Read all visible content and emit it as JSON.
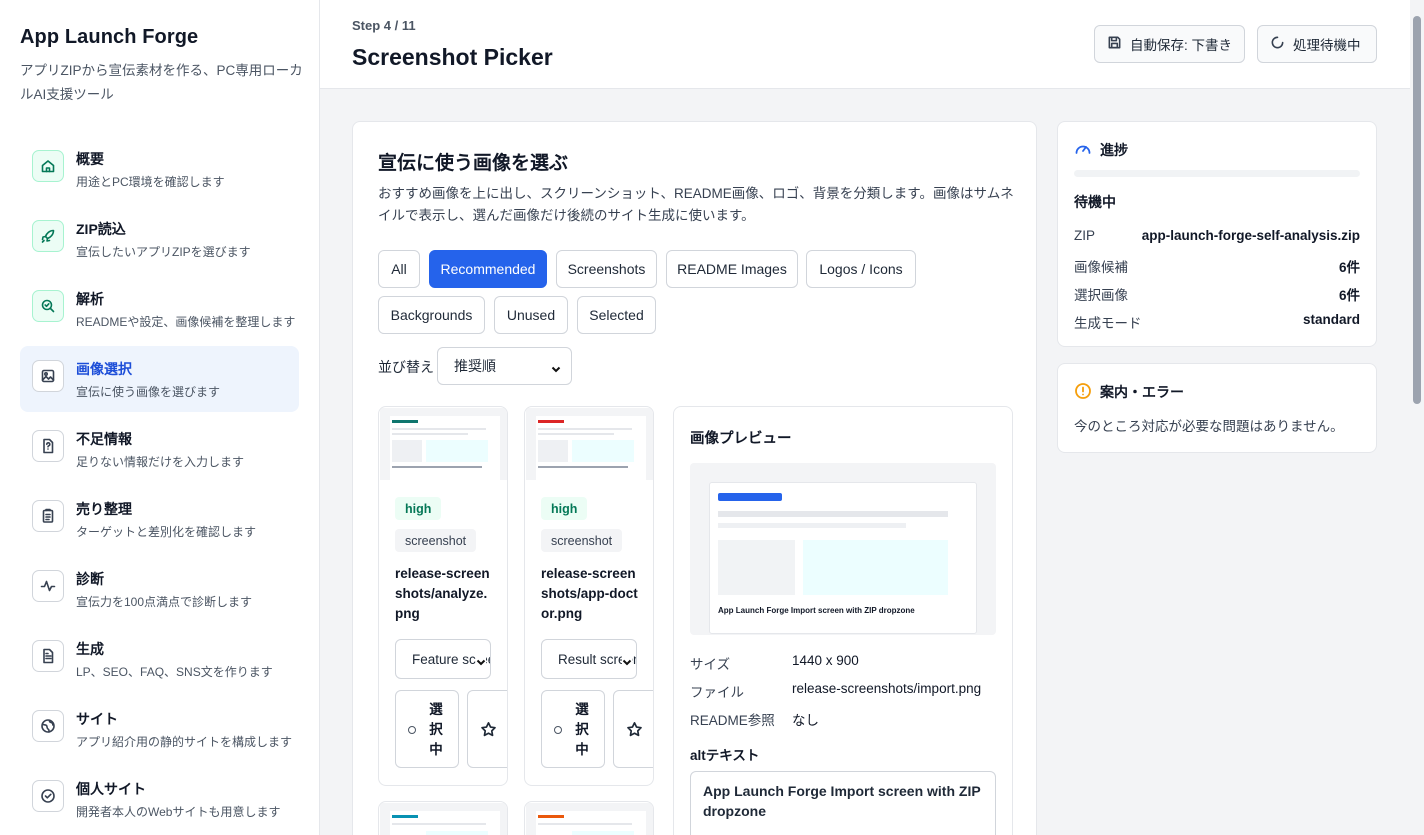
{
  "brand": {
    "title": "App Launch Forge",
    "subtitle": "アプリZIPから宣伝素材を作る、PC専用ローカルAI支援ツール"
  },
  "nav": [
    {
      "label": "概要",
      "desc": "用途とPC環境を確認します",
      "icon": "home-icon"
    },
    {
      "label": "ZIP読込",
      "desc": "宣伝したいアプリZIPを選びます",
      "icon": "rocket-icon"
    },
    {
      "label": "解析",
      "desc": "READMEや設定、画像候補を整理します",
      "icon": "search-check-icon"
    },
    {
      "label": "画像選択",
      "desc": "宣伝に使う画像を選びます",
      "icon": "image-icon",
      "active": true
    },
    {
      "label": "不足情報",
      "desc": "足りない情報だけを入力します",
      "icon": "question-icon"
    },
    {
      "label": "売り整理",
      "desc": "ターゲットと差別化を確認します",
      "icon": "clipboard-icon"
    },
    {
      "label": "診断",
      "desc": "宣伝力を100点満点で診断します",
      "icon": "pulse-icon"
    },
    {
      "label": "生成",
      "desc": "LP、SEO、FAQ、SNS文を作ります",
      "icon": "document-icon"
    },
    {
      "label": "サイト",
      "desc": "アプリ紹介用の静的サイトを構成します",
      "icon": "globe-icon"
    },
    {
      "label": "個人サイト",
      "desc": "開発者本人のWebサイトも用意します",
      "icon": "check-circle-icon"
    }
  ],
  "header": {
    "step": "Step 4 / 11",
    "title": "Screenshot Picker",
    "autosave_label": "自動保存: 下書き",
    "status_label": "処理待機中"
  },
  "main": {
    "title": "宣伝に使う画像を選ぶ",
    "description": "おすすめ画像を上に出し、スクリーンショット、README画像、ロゴ、背景を分類します。画像はサムネイルで表示し、選んだ画像だけ後続のサイト生成に使います。",
    "filters": [
      "All",
      "Recommended",
      "Screenshots",
      "README Images",
      "Logos / Icons",
      "Backgrounds",
      "Unused",
      "Selected"
    ],
    "active_filter": "Recommended",
    "sort_label": "並び替え",
    "sort_value": "推奨順"
  },
  "cards": [
    {
      "badge": "high",
      "kind": "screenshot",
      "file": "release-screenshots/analyze.png",
      "role": "Feature screenshot",
      "select_label": "選択中",
      "accent": "#0f766e"
    },
    {
      "badge": "high",
      "kind": "screenshot",
      "file": "release-screenshots/app-doctor.png",
      "role": "Result screenshot",
      "select_label": "選択中",
      "accent": "#dc2626"
    }
  ],
  "partial_card_accents": [
    "#0891b2",
    "#ea580c"
  ],
  "preview": {
    "title": "画像プレビュー",
    "caption": "App Launch Forge Import screen with ZIP dropzone",
    "size_label": "サイズ",
    "size_value": "1440 x 900",
    "file_label": "ファイル",
    "file_value": "release-screenshots/import.png",
    "readme_label": "README参照",
    "readme_value": "なし",
    "alt_label": "altテキスト",
    "alt_value": "App Launch Forge Import screen with ZIP dropzone"
  },
  "progress": {
    "title": "進捗",
    "status": "待機中",
    "fraction": 0,
    "rows": [
      {
        "key": "ZIP",
        "value": "app-launch-forge-self-analysis.zip"
      },
      {
        "key": "画像候補",
        "value": "6件"
      },
      {
        "key": "選択画像",
        "value": "6件"
      },
      {
        "key": "生成モード",
        "value": "standard"
      }
    ]
  },
  "info": {
    "title": "案内・エラー",
    "message": "今のところ対応が必要な問題はありません。"
  },
  "colors": {
    "accent": "#2563eb",
    "success": "#047857",
    "warning": "#f59e0b"
  }
}
